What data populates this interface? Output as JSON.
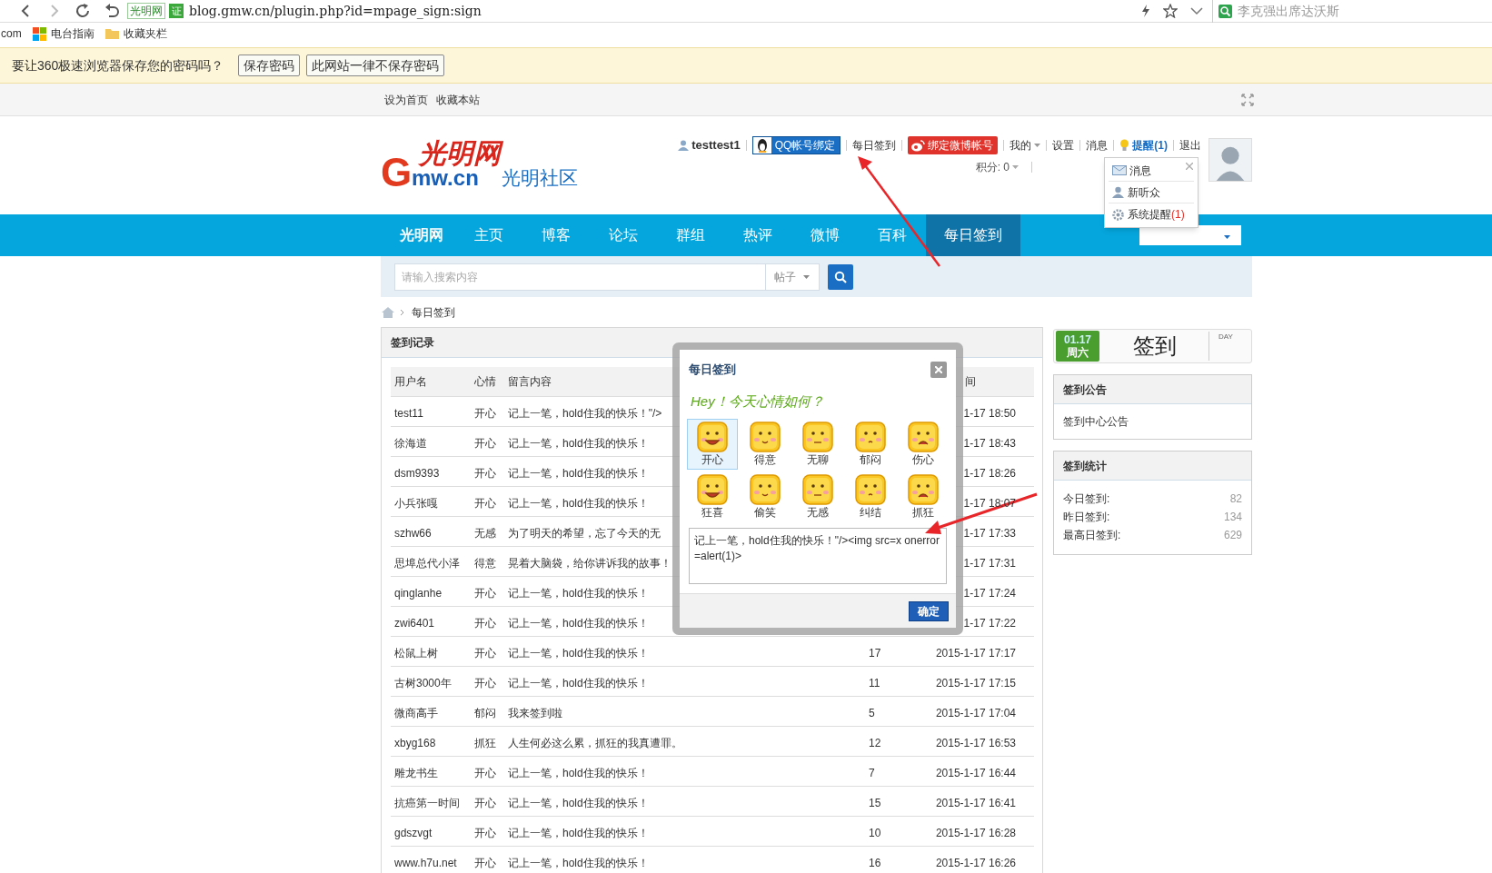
{
  "browser": {
    "site_tag": "光明网",
    "cert_badge": "证",
    "url": "blog.gmw.cn/plugin.php?id=mpage_sign:sign",
    "search_value": "李克强出席达沃斯"
  },
  "bookmarks": [
    {
      "kind": "plain",
      "label": "com"
    },
    {
      "kind": "tiles",
      "label": "电台指南"
    },
    {
      "kind": "folder",
      "label": "收藏夹栏"
    }
  ],
  "password_bar": {
    "message": "要让360极速浏览器保存您的密码吗？",
    "buttons": [
      "保存密码",
      "此网站一律不保存密码"
    ]
  },
  "top_links": [
    "设为首页",
    "收藏本站"
  ],
  "logo": {
    "calligraphy": "光明网",
    "domain_initial": "G",
    "domain_rest": "mw.cn",
    "community": "光明社区"
  },
  "user_bar": {
    "username": "testtest1",
    "items": [
      {
        "kind": "qq",
        "label": "QQ帐号绑定"
      },
      {
        "kind": "link",
        "label": "每日签到"
      },
      {
        "kind": "weibo",
        "label": "绑定微博帐号"
      },
      {
        "kind": "menu",
        "label": "我的"
      },
      {
        "kind": "link",
        "label": "设置"
      },
      {
        "kind": "link",
        "label": "消息"
      },
      {
        "kind": "alert",
        "label": "提醒(1)"
      },
      {
        "kind": "link",
        "label": "退出"
      }
    ],
    "points": "积分: 0"
  },
  "notify_menu": {
    "items": [
      {
        "kind": "mail",
        "label": "消息"
      },
      {
        "kind": "person",
        "label": "新听众"
      },
      {
        "kind": "gear",
        "label": "系统提醒",
        "count": "(1)"
      }
    ]
  },
  "nav": {
    "items": [
      {
        "kind": "brand",
        "label": "光明网",
        "selected": false
      },
      {
        "kind": "link",
        "label": "主页",
        "selected": false
      },
      {
        "kind": "link",
        "label": "博客",
        "selected": false
      },
      {
        "kind": "link",
        "label": "论坛",
        "selected": false
      },
      {
        "kind": "link",
        "label": "群组",
        "selected": false
      },
      {
        "kind": "link",
        "label": "热评",
        "selected": false
      },
      {
        "kind": "link",
        "label": "微博",
        "selected": false
      },
      {
        "kind": "link",
        "label": "百科",
        "selected": false
      },
      {
        "kind": "link",
        "label": "每日签到",
        "selected": true
      }
    ]
  },
  "search": {
    "placeholder": "请输入搜索内容",
    "scope": "帖子"
  },
  "breadcrumb": "每日签到",
  "records": {
    "title": "签到记录",
    "columns": [
      "用户名",
      "心情",
      "留言内容"
    ],
    "column_5": "间",
    "rows": [
      {
        "user": "test11",
        "mood": "开心",
        "message": "记上一笔，hold住我的快乐！\"/>",
        "time": "1-17 18:50"
      },
      {
        "user": "徐海道",
        "mood": "开心",
        "message": "记上一笔，hold住我的快乐！",
        "time": "1-17 18:43"
      },
      {
        "user": "dsm9393",
        "mood": "开心",
        "message": "记上一笔，hold住我的快乐！",
        "time": "1-17 18:26"
      },
      {
        "user": "小兵张嘎",
        "mood": "开心",
        "message": "记上一笔，hold住我的快乐！",
        "time": "1-17 18:07"
      },
      {
        "user": "szhw66",
        "mood": "无感",
        "message": "为了明天的希望，忘了今天的无",
        "time": "1-17 17:33"
      },
      {
        "user": "思埠总代小泽",
        "mood": "得意",
        "message": "晃着大脑袋，给你讲诉我的故事！",
        "time": "1-17 17:31"
      },
      {
        "user": "qinglanhe",
        "mood": "开心",
        "message": "记上一笔，hold住我的快乐！",
        "time": "1-17 17:24"
      },
      {
        "user": "zwi6401",
        "mood": "开心",
        "message": "记上一笔，hold住我的快乐！",
        "time": "1-17 17:22"
      },
      {
        "user": "松鼠上树",
        "mood": "开心",
        "message": "记上一笔，hold住我的快乐！",
        "count": "17",
        "time": "2015-1-17 17:17"
      },
      {
        "user": "古树3000年",
        "mood": "开心",
        "message": "记上一笔，hold住我的快乐！",
        "count": "11",
        "time": "2015-1-17 17:15"
      },
      {
        "user": "微商高手",
        "mood": "郁闷",
        "message": "我来签到啦",
        "count": "5",
        "time": "2015-1-17 17:04"
      },
      {
        "user": "xbyg168",
        "mood": "抓狂",
        "message": "人生何必这么累，抓狂的我真遭罪。",
        "count": "12",
        "time": "2015-1-17 16:53"
      },
      {
        "user": "雕龙书生",
        "mood": "开心",
        "message": "记上一笔，hold住我的快乐！",
        "count": "7",
        "time": "2015-1-17 16:44"
      },
      {
        "user": "抗癌第一时间",
        "mood": "开心",
        "message": "记上一笔，hold住我的快乐！",
        "count": "15",
        "time": "2015-1-17 16:41"
      },
      {
        "user": "gdszvgt",
        "mood": "开心",
        "message": "记上一笔，hold住我的快乐！",
        "count": "10",
        "time": "2015-1-17 16:28"
      },
      {
        "user": "www.h7u.net",
        "mood": "开心",
        "message": "记上一笔，hold住我的快乐！",
        "count": "16",
        "time": "2015-1-17 16:26"
      }
    ]
  },
  "sidebar": {
    "sign_card": {
      "date": "01.17",
      "weekday": "周六",
      "action": "签到",
      "unit": "DAY"
    },
    "notice": {
      "title": "签到公告",
      "body": "签到中心公告"
    },
    "stats": {
      "title": "签到统计",
      "items": [
        {
          "label": "今日签到:",
          "value": "82"
        },
        {
          "label": "昨日签到:",
          "value": "134"
        },
        {
          "label": "最高日签到:",
          "value": "629"
        }
      ]
    }
  },
  "dialog": {
    "title": "每日签到",
    "greeting": "Hey！今天心情如何？",
    "moods": [
      {
        "label": "开心",
        "selected": true
      },
      {
        "label": "得意",
        "selected": false
      },
      {
        "label": "无聊",
        "selected": false
      },
      {
        "label": "郁闷",
        "selected": false
      },
      {
        "label": "伤心",
        "selected": false
      },
      {
        "label": "狂喜",
        "selected": false
      },
      {
        "label": "偷笑",
        "selected": false
      },
      {
        "label": "无感",
        "selected": false
      },
      {
        "label": "纠结",
        "selected": false
      },
      {
        "label": "抓狂",
        "selected": false
      }
    ],
    "message": "记上一笔，hold住我的快乐！\"/><img src=x onerror=alert(1)>",
    "submit": "确定"
  }
}
